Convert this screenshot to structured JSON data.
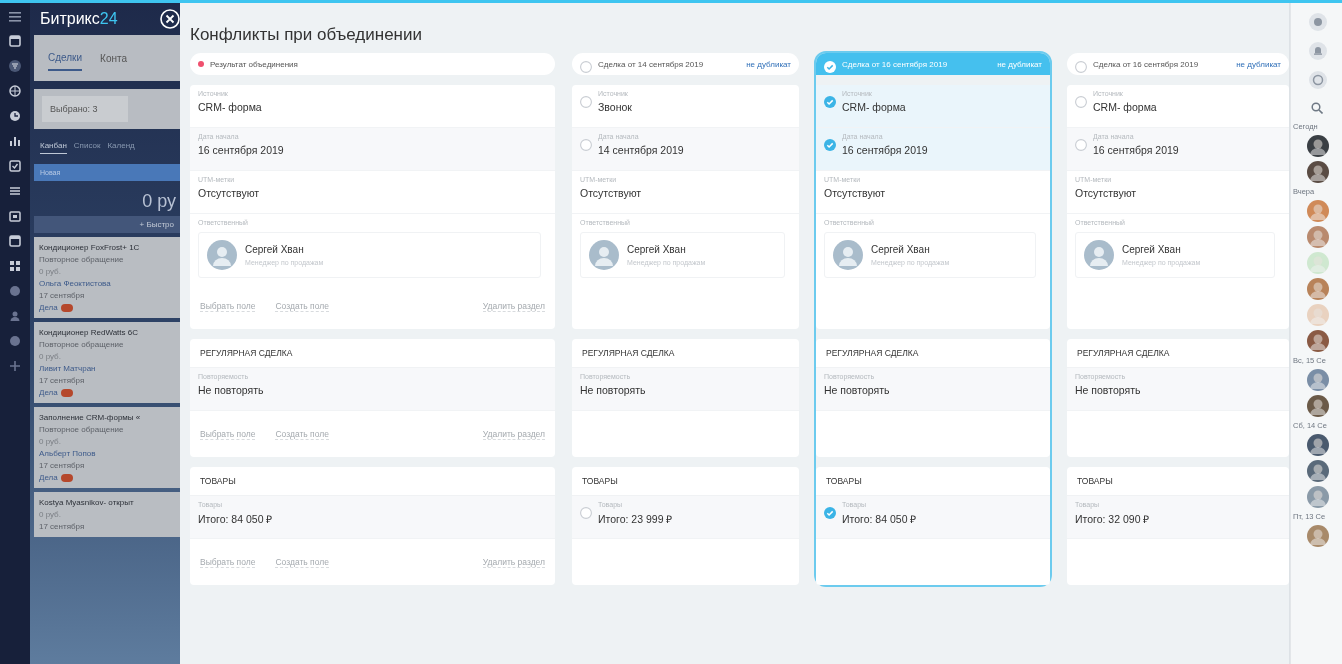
{
  "crm": {
    "logo_word": "Битрикс",
    "logo_number": "24",
    "tabs": [
      {
        "label": "Сделки",
        "selected": true
      },
      {
        "label": "Конта",
        "selected": false
      }
    ],
    "filter": {
      "value": "Выбрано: 3"
    },
    "views": [
      {
        "label": "Канбан",
        "selected": true
      },
      {
        "label": "Список",
        "selected": false
      },
      {
        "label": "Календ",
        "selected": false
      }
    ],
    "stage": {
      "title": "Новая",
      "sum": "0 ру",
      "quick_add": "+ Быстро"
    },
    "cards": [
      {
        "title": "Кондиционер FoxFrost+ 1С",
        "subtitle": "Повторное обращение",
        "amount": "0 руб.",
        "person": "Ольга Феоктистова",
        "date": "17 сентября",
        "activity": "Дела"
      },
      {
        "title": "Кондиционер RedWatts 6С",
        "subtitle": "Повторное обращение",
        "amount": "0 руб.",
        "person": "Ливит Матчран",
        "date": "17 сентября",
        "activity": "Дела"
      },
      {
        "title": "Заполнение CRM-формы «",
        "subtitle": "Повторное обращение",
        "amount": "0 руб.",
        "person": "Альберт Попов",
        "date": "17 сентября",
        "activity": "Дела"
      },
      {
        "title": "Kostya Myasnikov- открыт",
        "amount": "0 руб.",
        "date": "17 сентября"
      }
    ]
  },
  "slider": {
    "title": "Конфликты при объединении",
    "columns": [
      {
        "kind": "result",
        "header": "Результат объединения",
        "selected": false,
        "sections": [
          {
            "fields": [
              {
                "kind": "text",
                "label": "Источник",
                "value": "CRM- форма"
              },
              {
                "kind": "text",
                "label": "Дата начала",
                "value": "16 сентября 2019"
              },
              {
                "kind": "text",
                "label": "UTM-метки",
                "value": "Отсутствуют"
              },
              {
                "kind": "user",
                "label": "Ответственный",
                "name": "Сергей Хван",
                "position": "Менеджер по продажам"
              }
            ],
            "actions": [
              "Выбрать поле",
              "Создать поле",
              "Удалить раздел"
            ]
          },
          {
            "title": "РЕГУЛЯРНАЯ СДЕЛКА",
            "fields": [
              {
                "kind": "text",
                "label": "Повторяемость",
                "value": "Не повторять"
              }
            ],
            "actions": [
              "Выбрать поле",
              "Создать поле",
              "Удалить раздел"
            ]
          },
          {
            "title": "ТОВАРЫ",
            "fields": [
              {
                "kind": "text",
                "label": "Товары",
                "value": "Итого:  84 050 ₽"
              }
            ],
            "actions": [
              "Выбрать поле",
              "Создать поле",
              "Удалить раздел"
            ]
          }
        ]
      },
      {
        "kind": "source",
        "header": "Сделка от 14 сентября 2019",
        "link": "не дубликат",
        "selected": false,
        "sections": [
          {
            "fields": [
              {
                "kind": "text",
                "label": "Источник",
                "value": "Звонок",
                "checked": false
              },
              {
                "kind": "text",
                "label": "Дата начала",
                "value": "14 сентября 2019",
                "checked": false
              },
              {
                "kind": "text",
                "label": "UTM-метки",
                "value": "Отсутствуют"
              },
              {
                "kind": "user",
                "label": "Ответственный",
                "name": "Сергей Хван",
                "position": "Менеджер по продажам"
              }
            ]
          },
          {
            "title": "РЕГУЛЯРНАЯ СДЕЛКА",
            "fields": [
              {
                "kind": "text",
                "label": "Повторяемость",
                "value": "Не повторять"
              }
            ]
          },
          {
            "title": "ТОВАРЫ",
            "fields": [
              {
                "kind": "text",
                "label": "Товары",
                "value": "Итого:  23 999 ₽",
                "checked": false
              }
            ]
          }
        ]
      },
      {
        "kind": "source",
        "header": "Сделка от 16 сентября 2019",
        "link": "не дубликат",
        "selected": true,
        "sections": [
          {
            "fields": [
              {
                "kind": "text",
                "label": "Источник",
                "value": "CRM- форма",
                "checked": true
              },
              {
                "kind": "text",
                "label": "Дата начала",
                "value": "16 сентября 2019",
                "checked": true
              },
              {
                "kind": "text",
                "label": "UTM-метки",
                "value": "Отсутствуют"
              },
              {
                "kind": "user",
                "label": "Ответственный",
                "name": "Сергей Хван",
                "position": "Менеджер по продажам"
              }
            ]
          },
          {
            "title": "РЕГУЛЯРНАЯ СДЕЛКА",
            "fields": [
              {
                "kind": "text",
                "label": "Повторяемость",
                "value": "Не повторять"
              }
            ]
          },
          {
            "title": "ТОВАРЫ",
            "fields": [
              {
                "kind": "text",
                "label": "Товары",
                "value": "Итого:  84 050 ₽",
                "checked": true
              }
            ]
          }
        ]
      },
      {
        "kind": "source",
        "header": "Сделка от 16 сентября 2019",
        "link": "не дубликат",
        "selected": false,
        "sections": [
          {
            "fields": [
              {
                "kind": "text",
                "label": "Источник",
                "value": "CRM- форма",
                "checked": false
              },
              {
                "kind": "text",
                "label": "Дата начала",
                "value": "16 сентября 2019",
                "checked": false
              },
              {
                "kind": "text",
                "label": "UTM-метки",
                "value": "Отсутствуют"
              },
              {
                "kind": "user",
                "label": "Ответственный",
                "name": "Сергей Хван",
                "position": "Менеджер по продажам"
              }
            ]
          },
          {
            "title": "РЕГУЛЯРНАЯ СДЕЛКА",
            "fields": [
              {
                "kind": "text",
                "label": "Повторяемость",
                "value": "Не повторять"
              }
            ]
          },
          {
            "title": "ТОВАРЫ",
            "fields": [
              {
                "kind": "text",
                "label": "Товары",
                "value": "Итого:  32 090 ₽"
              }
            ]
          }
        ]
      }
    ]
  },
  "right_panel": {
    "groups": [
      {
        "label": "Сегодн"
      },
      {
        "label": "Вчера"
      },
      {
        "label": "Вс, 15 Се"
      },
      {
        "label": "Сб, 14 Се"
      },
      {
        "label": "Пт, 13 Се"
      }
    ]
  }
}
